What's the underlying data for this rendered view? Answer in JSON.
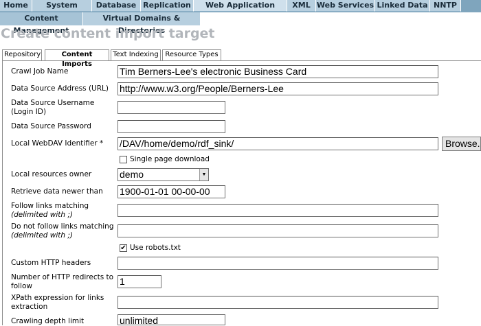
{
  "nav": {
    "tabs": [
      {
        "label": "Home",
        "active": false
      },
      {
        "label": "System Admin",
        "active": false
      },
      {
        "label": "Database",
        "active": false
      },
      {
        "label": "Replication",
        "active": false
      },
      {
        "label": "Web Application Server",
        "active": true
      },
      {
        "label": "XML",
        "active": false
      },
      {
        "label": "Web Services",
        "active": false
      },
      {
        "label": "Linked Data",
        "active": false
      },
      {
        "label": "NNTP",
        "active": false
      }
    ],
    "subtabs": [
      {
        "label": "Content Management",
        "active": true
      },
      {
        "label": "Virtual Domains & Directories",
        "active": false
      }
    ]
  },
  "page": {
    "title": "Create content import target"
  },
  "inner_tabs": [
    {
      "label": "Repository",
      "active": false
    },
    {
      "label": "Content Imports",
      "active": true
    },
    {
      "label": "Text Indexing",
      "active": false
    },
    {
      "label": "Resource Types",
      "active": false
    }
  ],
  "form": {
    "crawl_job_name": {
      "label": "Crawl Job Name",
      "value": "Tim Berners-Lee's electronic Business Card"
    },
    "source_url": {
      "label": "Data Source Address (URL)",
      "value": "http://www.w3.org/People/Berners-Lee"
    },
    "source_username": {
      "label": "Data Source Username (Login ID)",
      "value": ""
    },
    "source_password": {
      "label": "Data Source Password",
      "value": ""
    },
    "webdav_id": {
      "label": "Local WebDAV Identifier *",
      "value": "/DAV/home/demo/rdf_sink/",
      "browse_label": "Browse..."
    },
    "single_page": {
      "label": "Single page download",
      "checked": false
    },
    "owner": {
      "label": "Local resources owner",
      "value": "demo"
    },
    "newer_than": {
      "label": "Retrieve data newer than",
      "value": "1900-01-01 00-00-00"
    },
    "follow_links": {
      "label": "Follow links matching",
      "hint": "(delimited with ;)",
      "value": ""
    },
    "no_follow_links": {
      "label": "Do not follow links matching",
      "hint": "(delimited with ;)",
      "value": ""
    },
    "robots": {
      "label": "Use robots.txt",
      "checked": true,
      "mark": "✔"
    },
    "http_headers": {
      "label": "Custom HTTP headers",
      "value": ""
    },
    "redirects": {
      "label": "Number of HTTP redirects to follow",
      "value": "1"
    },
    "xpath": {
      "label": "XPath expression for links extraction",
      "value": ""
    },
    "depth": {
      "label": "Crawling depth limit",
      "value": "unlimited"
    }
  }
}
